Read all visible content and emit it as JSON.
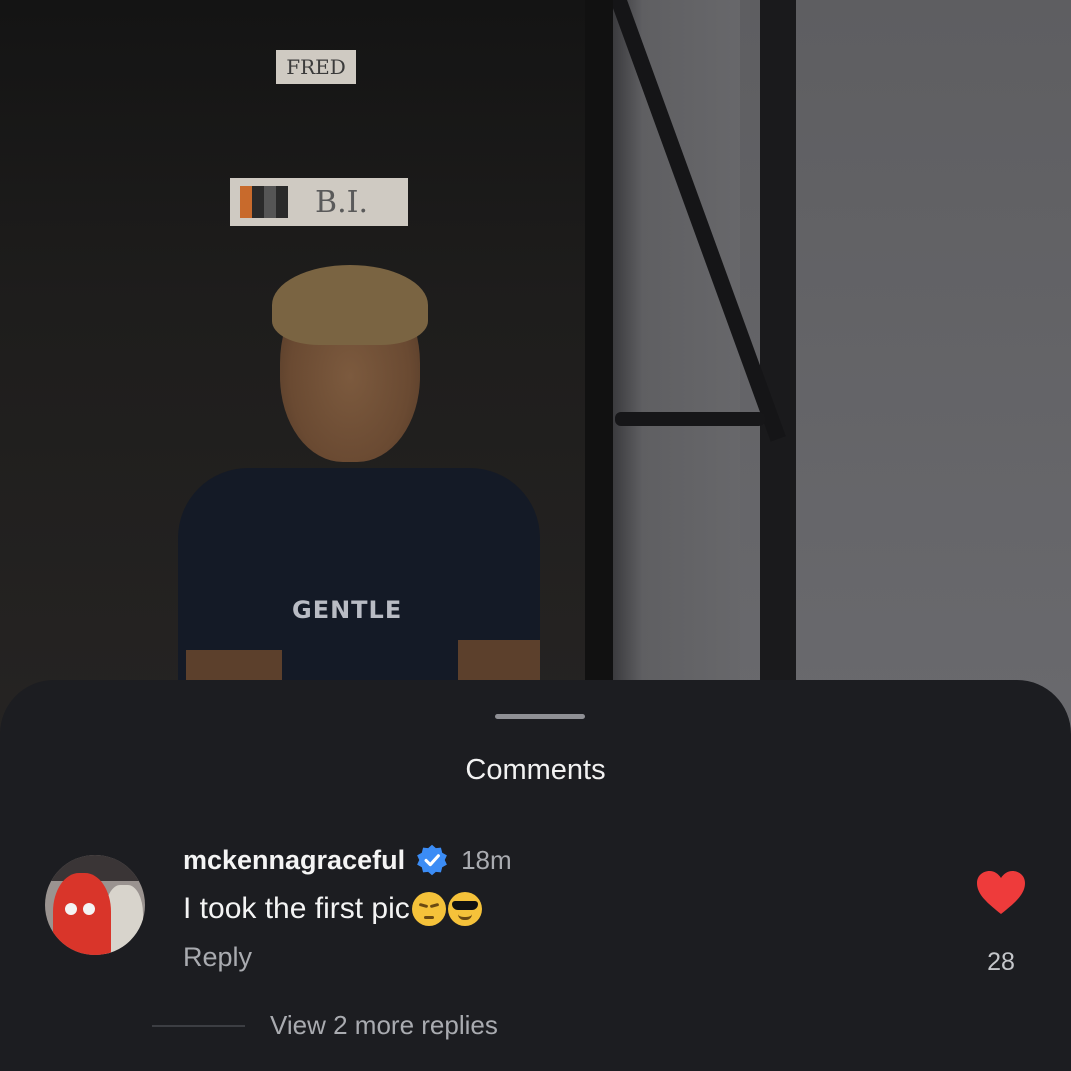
{
  "photo": {
    "sticker_fred": "FRED",
    "sticker_logo": "B.I.",
    "shirt_print": "GENTLE"
  },
  "comments_sheet": {
    "title": "Comments",
    "comment": {
      "username": "mckennagraceful",
      "verified": true,
      "timestamp": "18m",
      "text": "I took the first pic",
      "emojis": [
        "pensive-face-emoji",
        "smiling-face-with-sunglasses-emoji"
      ],
      "reply_label": "Reply",
      "like_count": "28",
      "liked": true,
      "view_more_replies_label": "View 2 more replies"
    }
  },
  "colors": {
    "sheet_background": "#1c1d21",
    "primary_text": "#f4f4f4",
    "secondary_text": "#a9abb0",
    "verified_badge": "#3b8cf5",
    "heart_liked": "#ee3b3b"
  }
}
